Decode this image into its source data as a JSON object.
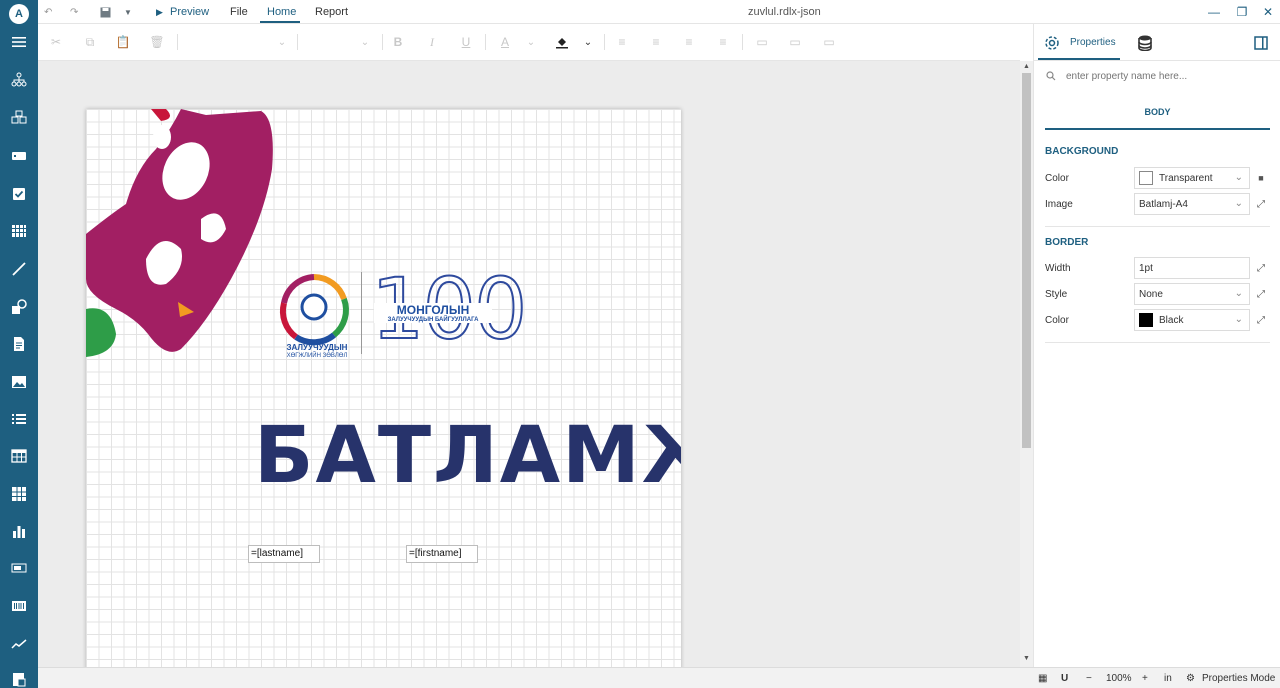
{
  "app": {
    "logo_letter": "A",
    "doc_title": "zuvlul.rdlx-json"
  },
  "menubar": {
    "preview_label": "Preview",
    "menus": [
      "File",
      "Home",
      "Report"
    ],
    "active_menu": "Home"
  },
  "toolbar": {
    "font_name": "",
    "font_size": ""
  },
  "report": {
    "logo_caption_line1": "ЗАЛУУЧУУДЫН",
    "logo_caption_line2": "ХӨГЖЛИЙН ЗӨВЛӨЛ",
    "logo_number": "100",
    "logo_right_line1": "МОНГОЛЫН",
    "logo_right_line2": "ЗАЛУУЧУУДЫН БАЙГУУЛЛАГА",
    "title": "БАТЛАМЖ",
    "field_lastname": "=[lastname]",
    "field_firstname": "=[firstname]"
  },
  "properties": {
    "tab_properties": "Properties",
    "search_placeholder": "enter property name here...",
    "object_name": "BODY",
    "background_section": "BACKGROUND",
    "bg_color_label": "Color",
    "bg_color_value": "Transparent",
    "bg_image_label": "Image",
    "bg_image_value": "Batlamj-A4",
    "border_section": "BORDER",
    "border_width_label": "Width",
    "border_width_value": "1pt",
    "border_style_label": "Style",
    "border_style_value": "None",
    "border_color_label": "Color",
    "border_color_value": "Black"
  },
  "statusbar": {
    "zoom": "100%",
    "unit": "in",
    "mode_label": "Properties Mode"
  },
  "colors": {
    "accent": "#1e5f80",
    "sidebar": "#1e5f80",
    "title_text": "#27336b",
    "magenta": "#a21f63",
    "green": "#2e9d48",
    "orange": "#f29b21"
  },
  "icons": {
    "sidebar": [
      "menu-icon",
      "tree-icon",
      "group-icon",
      "textbox-icon",
      "checkbox-icon",
      "barcode-grid-icon",
      "line-icon",
      "shape-icon",
      "richtext-icon",
      "image-icon",
      "list-icon",
      "table-icon",
      "matrix-icon",
      "chart-icon",
      "sparkline-bar-icon",
      "barcode-icon",
      "sparkline-icon",
      "subreport-icon"
    ]
  }
}
